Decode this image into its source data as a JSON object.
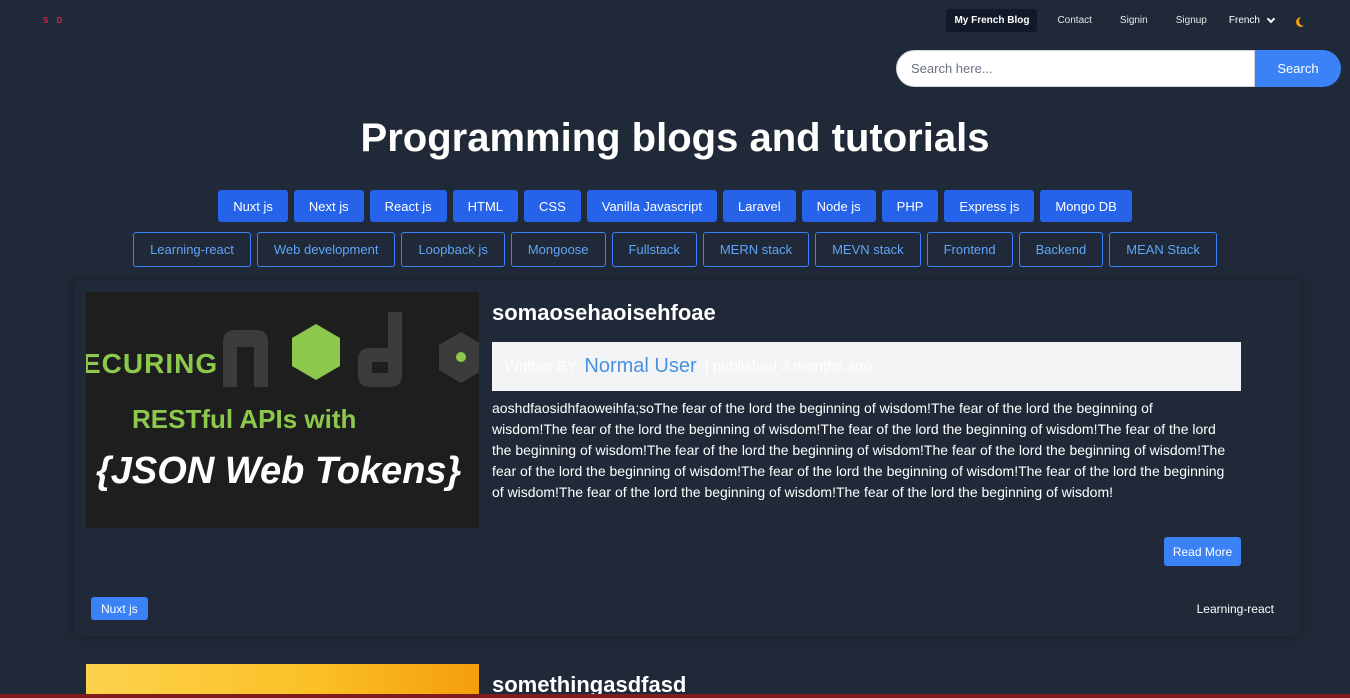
{
  "nav": {
    "logo": "S D",
    "links": [
      "My French Blog",
      "Contact",
      "Signin",
      "Signup"
    ],
    "language": "French",
    "moon_icon": "moon-icon"
  },
  "search": {
    "placeholder": "Search here...",
    "button": "Search"
  },
  "page_title": "Programming blogs and tutorials",
  "categories": [
    "Nuxt js",
    "Next js",
    "React js",
    "HTML",
    "CSS",
    "Vanilla Javascript",
    "Laravel",
    "Node js",
    "PHP",
    "Express js",
    "Mongo DB"
  ],
  "tags": [
    "Learning-react",
    "Web development",
    "Loopback js",
    "Mongoose",
    "Fullstack",
    "MERN stack",
    "MEVN stack",
    "Frontend",
    "Backend",
    "MEAN Stack"
  ],
  "posts": [
    {
      "title": "somaosehaoisehfoae",
      "image_text": {
        "line1": "ECURING",
        "line2": "RESTful APIs with",
        "line3": "{JSON Web Tokens}"
      },
      "written_by_label": "Written BY",
      "author": "Normal User",
      "published": "| published 3 months ago",
      "excerpt": "aoshdfaosidhfaoweihfa;soThe fear of the lord the beginning of wisdom!The fear of the lord the beginning of wisdom!The fear of the lord the beginning of wisdom!The fear of the lord the beginning of wisdom!The fear of the lord the beginning of wisdom!The fear of the lord the beginning of wisdom!The fear of the lord the beginning of wisdom!The fear of the lord the beginning of wisdom!The fear of the lord the beginning of wisdom!The fear of the lord the beginning of wisdom!The fear of the lord the beginning of wisdom!The fear of the lord the beginning of wisdom!",
      "read_more": "Read More",
      "category": "Nuxt js",
      "tag": "Learning-react"
    },
    {
      "title": "somethingasdfasd"
    }
  ],
  "colors": {
    "background": "#1f2937",
    "accent": "#3b82f6",
    "category_bg": "#2563eb"
  }
}
